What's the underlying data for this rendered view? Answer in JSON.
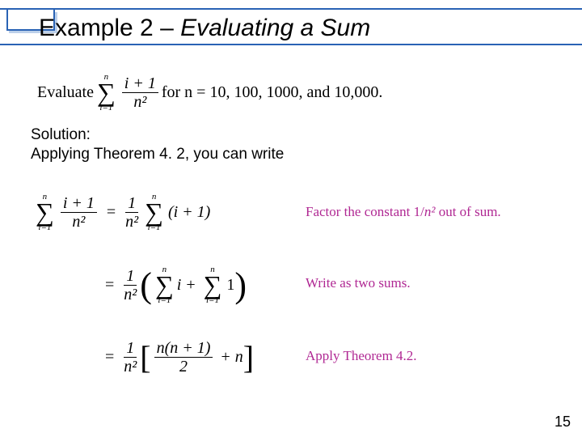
{
  "title": {
    "prefix": "Example 2 – ",
    "italic": "Evaluating a Sum"
  },
  "evaluate": {
    "lead": "Evaluate",
    "sum_upper": "n",
    "sum_lower": "i=1",
    "frac_num": "i + 1",
    "frac_den": "n²",
    "tail": " for n = 10, 100, 1000, and 10,000."
  },
  "solution": {
    "heading": "Solution:",
    "line1": "Applying Theorem 4. 2, you can write"
  },
  "eq1": {
    "lhs_sum_upper": "n",
    "lhs_sum_lower": "i=1",
    "lhs_frac_num": "i + 1",
    "lhs_frac_den": "n²",
    "eq": "=",
    "rfrac_num": "1",
    "rfrac_den": "n²",
    "rsum_upper": "n",
    "rsum_lower": "i=1",
    "rexpr": "(i + 1)"
  },
  "eq2": {
    "eq": "=",
    "frac_num": "1",
    "frac_den": "n²",
    "sumA_upper": "n",
    "sumA_lower": "i=1",
    "termA": "i",
    "plus": "+",
    "sumB_upper": "n",
    "sumB_lower": "i=1",
    "termB": "1"
  },
  "eq3": {
    "eq": "=",
    "frac_num": "1",
    "frac_den": "n²",
    "inner_num": "n(n + 1)",
    "inner_den": "2",
    "plus": "+",
    "termB": "n"
  },
  "annotations": {
    "a1_pre": "Factor the constant 1/",
    "a1_n2": "n²",
    "a1_post": " out of sum.",
    "a2": "Write as two sums.",
    "a3": "Apply Theorem 4.2."
  },
  "page": "15"
}
